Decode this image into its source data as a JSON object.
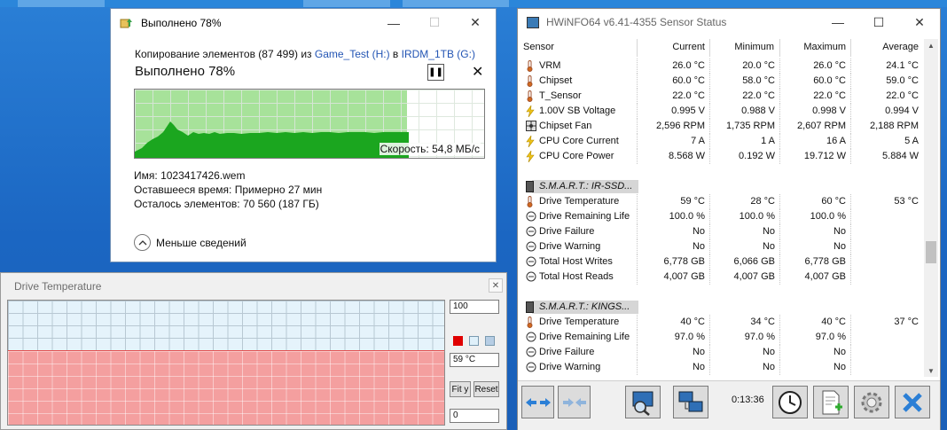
{
  "copy_dialog": {
    "title": "Выполнено 78%",
    "copy_prefix": "Копирование элементов (87 499) из ",
    "source_link": "Game_Test (H:)",
    "middle": " в ",
    "dest_link": "IRDM_1TB (G:)",
    "percent_label": "Выполнено 78%",
    "progress_fraction": 0.78,
    "speed_label": "Скорость: 54,8 МБ/с",
    "name_label": "Имя:",
    "name_value": "1023417426.wem",
    "time_label": "Оставшееся время:",
    "time_value": "Примерно 27 мин",
    "items_label": "Осталось элементов:",
    "items_value": "70 560 (187 ГБ)",
    "less_details": "Меньше сведений",
    "icons": {
      "app": "copy-files-icon",
      "pause": "pause-icon",
      "cancel": "close-icon",
      "collapse": "chevron-up-icon"
    }
  },
  "temp_window": {
    "title": "Drive Temperature",
    "max_value": "100",
    "current_value": "59 °C",
    "min_value": "0",
    "fit_label": "Fit y",
    "reset_label": "Reset",
    "current_temp": 59,
    "scale_max": 100,
    "colors": {
      "fill": "#f49f9f",
      "line": "#e24a4a",
      "background": "#e5f3fb"
    }
  },
  "hwinfo": {
    "title": "HWiNFO64 v6.41-4355 Sensor Status",
    "columns": [
      "Sensor",
      "Current",
      "Minimum",
      "Maximum",
      "Average"
    ],
    "timer": "0:13:36",
    "rows": [
      {
        "type": "sensor",
        "icon": "thermometer-icon",
        "name": "VRM",
        "cur": "26.0 °C",
        "min": "20.0 °C",
        "max": "26.0 °C",
        "avg": "24.1 °C"
      },
      {
        "type": "sensor",
        "icon": "thermometer-icon",
        "name": "Chipset",
        "cur": "60.0 °C",
        "min": "58.0 °C",
        "max": "60.0 °C",
        "avg": "59.0 °C"
      },
      {
        "type": "sensor",
        "icon": "thermometer-icon",
        "name": "T_Sensor",
        "cur": "22.0 °C",
        "min": "22.0 °C",
        "max": "22.0 °C",
        "avg": "22.0 °C"
      },
      {
        "type": "sensor",
        "icon": "bolt-icon",
        "name": "1.00V SB Voltage",
        "cur": "0.995 V",
        "min": "0.988 V",
        "max": "0.998 V",
        "avg": "0.994 V"
      },
      {
        "type": "sensor",
        "icon": "fan-icon",
        "name": "Chipset Fan",
        "cur": "2,596 RPM",
        "min": "1,735 RPM",
        "max": "2,607 RPM",
        "avg": "2,188 RPM"
      },
      {
        "type": "sensor",
        "icon": "bolt-icon",
        "name": "CPU Core Current",
        "cur": "7 A",
        "min": "1 A",
        "max": "16 A",
        "avg": "5 A"
      },
      {
        "type": "sensor",
        "icon": "bolt-icon",
        "name": "CPU Core Power",
        "cur": "8.568 W",
        "min": "0.192 W",
        "max": "19.712 W",
        "avg": "5.884 W"
      },
      {
        "type": "blank"
      },
      {
        "type": "group",
        "icon": "drive-icon",
        "name": "S.M.A.R.T.: IR-SSD..."
      },
      {
        "type": "sensor",
        "icon": "thermometer-icon",
        "name": "Drive Temperature",
        "cur": "59 °C",
        "min": "28 °C",
        "max": "60 °C",
        "avg": "53 °C"
      },
      {
        "type": "sensor",
        "icon": "gauge-icon",
        "name": "Drive Remaining Life",
        "cur": "100.0 %",
        "min": "100.0 %",
        "max": "100.0 %",
        "avg": ""
      },
      {
        "type": "sensor",
        "icon": "gauge-icon",
        "name": "Drive Failure",
        "cur": "No",
        "min": "No",
        "max": "No",
        "avg": ""
      },
      {
        "type": "sensor",
        "icon": "gauge-icon",
        "name": "Drive Warning",
        "cur": "No",
        "min": "No",
        "max": "No",
        "avg": ""
      },
      {
        "type": "sensor",
        "icon": "gauge-icon",
        "name": "Total Host Writes",
        "cur": "6,778 GB",
        "min": "6,066 GB",
        "max": "6,778 GB",
        "avg": ""
      },
      {
        "type": "sensor",
        "icon": "gauge-icon",
        "name": "Total Host Reads",
        "cur": "4,007 GB",
        "min": "4,007 GB",
        "max": "4,007 GB",
        "avg": ""
      },
      {
        "type": "blank"
      },
      {
        "type": "group",
        "icon": "drive-icon",
        "name": "S.M.A.R.T.: KINGS..."
      },
      {
        "type": "sensor",
        "icon": "thermometer-icon",
        "name": "Drive Temperature",
        "cur": "40 °C",
        "min": "34 °C",
        "max": "40 °C",
        "avg": "37 °C"
      },
      {
        "type": "sensor",
        "icon": "gauge-icon",
        "name": "Drive Remaining Life",
        "cur": "97.0 %",
        "min": "97.0 %",
        "max": "97.0 %",
        "avg": ""
      },
      {
        "type": "sensor",
        "icon": "gauge-icon",
        "name": "Drive Failure",
        "cur": "No",
        "min": "No",
        "max": "No",
        "avg": ""
      },
      {
        "type": "sensor",
        "icon": "gauge-icon",
        "name": "Drive Warning",
        "cur": "No",
        "min": "No",
        "max": "No",
        "avg": ""
      }
    ],
    "toolbar": [
      {
        "name": "expand-arrows-icon"
      },
      {
        "name": "collapse-arrows-icon"
      },
      {
        "name": "monitor-search-icon"
      },
      {
        "name": "network-icon"
      },
      {
        "name": "clock-icon"
      },
      {
        "name": "add-report-icon"
      },
      {
        "name": "settings-gear-icon"
      },
      {
        "name": "close-icon"
      }
    ]
  }
}
